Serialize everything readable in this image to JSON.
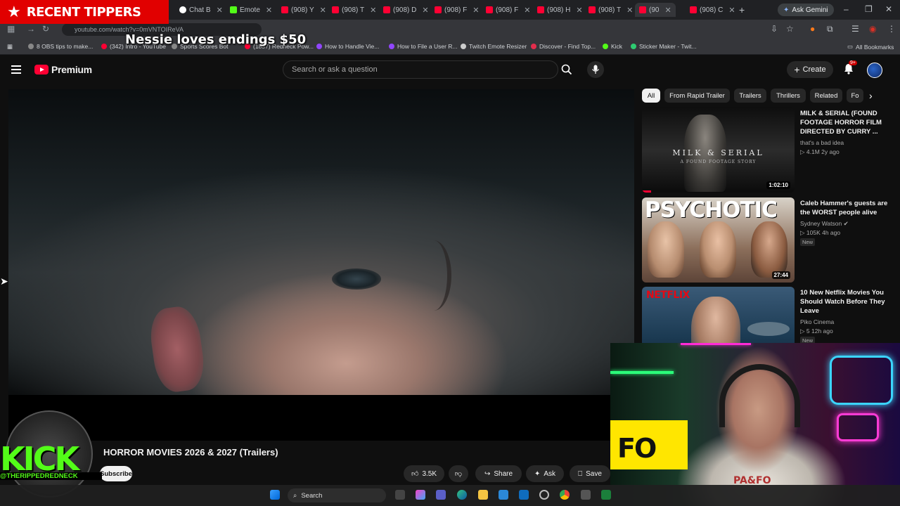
{
  "overlay": {
    "tippers_title": "RECENT TIPPERS",
    "tip_message": "Nessie loves endings $50"
  },
  "browser": {
    "tabs": [
      {
        "label": "Chat B",
        "icon": "chatgpt-icon"
      },
      {
        "label": "Emote",
        "icon": "kick-icon"
      },
      {
        "label": "(908) Y",
        "icon": "youtube-icon"
      },
      {
        "label": "(908) T",
        "icon": "youtube-icon"
      },
      {
        "label": "(908) D",
        "icon": "youtube-icon"
      },
      {
        "label": "(908) F",
        "icon": "youtube-icon"
      },
      {
        "label": "(908) F",
        "icon": "youtube-icon"
      },
      {
        "label": "(908) H",
        "icon": "youtube-icon"
      },
      {
        "label": "(908) T",
        "icon": "youtube-icon"
      },
      {
        "label": "(90",
        "icon": "youtube-icon",
        "active": true
      },
      {
        "label": "(908) C",
        "icon": "youtube-icon"
      }
    ],
    "ask_gemini": "Ask Gemini",
    "url": "youtube.com/watch?v=0mVNTOIReVA",
    "bookmarks": [
      "8 OBS tips to make...",
      "(342) Intro - YouTube",
      "Sports Scores Bot",
      "(1837) Redneck Pow...",
      "How to Handle Vie...",
      "How to File a User R...",
      "Twitch Emote Resizer",
      "Discover - Find Top...",
      "Kick",
      "Sticker Maker - Twit..."
    ],
    "all_bookmarks": "All Bookmarks"
  },
  "youtube": {
    "logo_text": "Premium",
    "search_placeholder": "Search or ask a question",
    "create_label": "Create",
    "notif_count": "9+",
    "video_title": "HORROR MOVIES 2026 & 2027 (Trailers)",
    "subscribe_label": "Subscribe",
    "likes": "3.5K",
    "share_label": "Share",
    "ask_label": "Ask",
    "save_label": "Save",
    "chips": [
      "All",
      "From Rapid Trailer",
      "Trailers",
      "Thrillers",
      "Related",
      "Fo"
    ],
    "recommendations": [
      {
        "title": "MILK & SERIAL (FOUND FOOTAGE HORROR FILM DIRECTED BY CURRY ...",
        "channel": "that's a bad idea",
        "meta": "▷ 4.1M  2y ago",
        "duration": "1:02:10",
        "thumb_text": "MILK & SERIAL",
        "thumb_sub": "A FOUND FOOTAGE STORY",
        "watched_fraction": 0.06
      },
      {
        "title": "Caleb Hammer's guests are the WORST people alive",
        "channel": "Sydney Watson",
        "meta": "▷ 105K  4h ago",
        "badge": "New",
        "duration": "27:44",
        "thumb_text": "PSYCHOTIC"
      },
      {
        "title": "10 New Netflix Movies You Should Watch Before They Leave",
        "channel": "Piko Cinema",
        "meta": "▷ 5  12h ago",
        "badge": "New",
        "thumb_text": "NETFLIX"
      }
    ]
  },
  "kick": {
    "word": "KICK",
    "handle": "@THERIPPEDREDNECK"
  },
  "webcam": {
    "sign_text": "FO",
    "shirt_text": "PA&FO"
  },
  "taskbar": {
    "search_label": "Search"
  }
}
